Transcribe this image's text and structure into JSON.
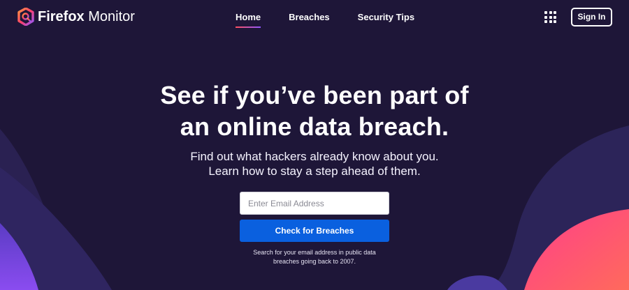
{
  "header": {
    "logo_bold": "Firefox",
    "logo_light": " Monitor",
    "nav": [
      {
        "label": "Home",
        "active": true
      },
      {
        "label": "Breaches",
        "active": false
      },
      {
        "label": "Security Tips",
        "active": false
      }
    ],
    "apps_icon": "grid-icon",
    "signin_label": "Sign In"
  },
  "hero": {
    "headline_line1": "See if you’ve been part of",
    "headline_line2": "an online data breach.",
    "sub_line1": "Find out what hackers already know about you.",
    "sub_line2": "Learn how to stay a step ahead of them.",
    "email_placeholder": "Enter Email Address",
    "email_value": "",
    "button_label": "Check for Breaches",
    "note_line1": "Search for your email address in public data",
    "note_line2": "breaches going back to 2007."
  },
  "colors": {
    "background": "#1e1638",
    "primary_button": "#0a60df",
    "accent_gradient_start": "#ff4f5e",
    "accent_gradient_end": "#9059ff"
  }
}
